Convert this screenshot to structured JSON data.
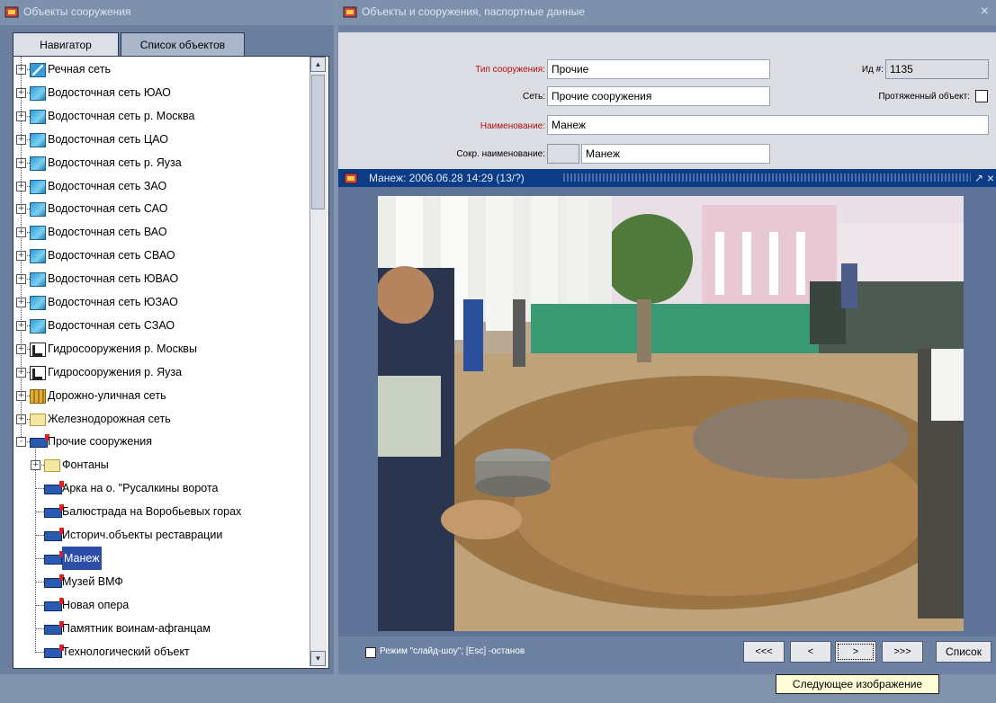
{
  "left_window": {
    "title": "Объекты сооружения",
    "tabs": [
      "Навигатор",
      "Список объектов"
    ]
  },
  "tree": {
    "items": [
      {
        "label": "Речная сеть",
        "icon": "river-network-icon",
        "level": 0,
        "expander": "+"
      },
      {
        "label": "Водосточная сеть ЮАО",
        "icon": "network-icon",
        "level": 0,
        "expander": "+"
      },
      {
        "label": "Водосточная сеть р. Москва",
        "icon": "network-icon",
        "level": 0,
        "expander": "+"
      },
      {
        "label": "Водосточная сеть ЦАО",
        "icon": "network-icon",
        "level": 0,
        "expander": "+"
      },
      {
        "label": "Водосточная сеть р. Яуза",
        "icon": "network-icon",
        "level": 0,
        "expander": "+"
      },
      {
        "label": "Водосточная сеть ЗАО",
        "icon": "network-icon",
        "level": 0,
        "expander": "+"
      },
      {
        "label": "Водосточная сеть САО",
        "icon": "network-icon",
        "level": 0,
        "expander": "+"
      },
      {
        "label": "Водосточная сеть ВАО",
        "icon": "network-icon",
        "level": 0,
        "expander": "+"
      },
      {
        "label": "Водосточная сеть СВАО",
        "icon": "network-icon",
        "level": 0,
        "expander": "+"
      },
      {
        "label": "Водосточная сеть ЮВАО",
        "icon": "network-icon",
        "level": 0,
        "expander": "+"
      },
      {
        "label": "Водосточная сеть ЮЗАО",
        "icon": "network-icon",
        "level": 0,
        "expander": "+"
      },
      {
        "label": "Водосточная сеть СЗАО",
        "icon": "network-icon",
        "level": 0,
        "expander": "+"
      },
      {
        "label": "Гидросооружения р. Москвы",
        "icon": "hydro-structure-icon",
        "level": 0,
        "expander": "+"
      },
      {
        "label": "Гидросооружения р. Яуза",
        "icon": "hydro-structure-icon",
        "level": 0,
        "expander": "+"
      },
      {
        "label": "Дорожно-уличная сеть",
        "icon": "road-network-icon",
        "level": 0,
        "expander": "+"
      },
      {
        "label": "Железнодорожная сеть",
        "icon": "folder-icon",
        "level": 0,
        "expander": "+"
      },
      {
        "label": "Прочие сооружения",
        "icon": "object-icon",
        "level": 0,
        "expander": "-"
      },
      {
        "label": "Фонтаны",
        "icon": "folder-icon",
        "level": 1,
        "expander": "+"
      },
      {
        "label": "Арка на о. \"Русалкины ворота",
        "icon": "object-icon",
        "level": 1,
        "expander": ""
      },
      {
        "label": "Балюстрада на Воробьевых горах",
        "icon": "object-icon",
        "level": 1,
        "expander": ""
      },
      {
        "label": "Историч.объекты реставрации",
        "icon": "object-icon",
        "level": 1,
        "expander": ""
      },
      {
        "label": "Манеж",
        "icon": "object-icon",
        "level": 1,
        "expander": "",
        "selected": true
      },
      {
        "label": "Музей ВМФ",
        "icon": "object-icon",
        "level": 1,
        "expander": ""
      },
      {
        "label": "Новая опера",
        "icon": "object-icon",
        "level": 1,
        "expander": ""
      },
      {
        "label": "Памятник воинам-афганцам",
        "icon": "object-icon",
        "level": 1,
        "expander": ""
      },
      {
        "label": "Технологический объект",
        "icon": "object-icon",
        "level": 1,
        "expander": ""
      }
    ]
  },
  "right_window": {
    "title": "Объекты и сооружения, паспортные данные",
    "close_glyph": "×"
  },
  "form": {
    "type_label": "Тип сооружения:",
    "type_value": "Прочие",
    "network_label": "Сеть:",
    "network_value": "Прочие сооружения",
    "name_label": "Наименование:",
    "name_value": "Манеж",
    "short_name_label": "Сокр. наименование:",
    "short_name_value": "Манеж",
    "id_label": "Ид #:",
    "id_value": "1135",
    "extended_label": "Протяженный объект:",
    "extended_checked": false
  },
  "image_viewer": {
    "title": "Манеж: 2006.06.28 14:29  (13/?)",
    "pin_glyph": "↗",
    "close_glyph": "×",
    "slideshow_label": "Режим \"слайд-шоу\"; [Esc] -останов",
    "buttons": {
      "first": "<<<",
      "prev": "<",
      "next": ">",
      "last": ">>>",
      "list": "Список"
    },
    "tooltip": "Следующее изображение"
  },
  "colors": {
    "selection": "#2d4ea8",
    "viewer_titlebar": "#0d3c86",
    "required_label": "#b01010"
  }
}
